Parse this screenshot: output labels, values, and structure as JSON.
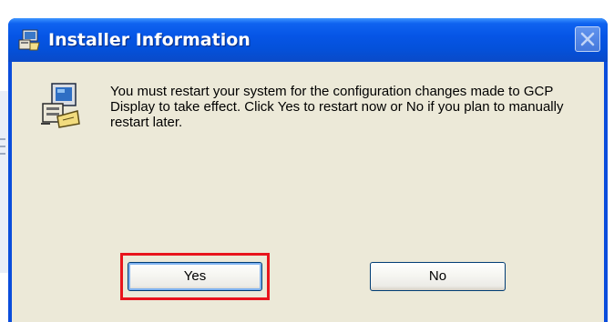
{
  "window": {
    "title": "Installer Information",
    "icon": "installer-icon",
    "close_icon": "close-icon"
  },
  "dialog": {
    "icon": "computer-setup-icon",
    "message": "You must restart your system for the configuration changes made to GCP Display to take effect. Click Yes to restart now or No if you plan to manually restart later."
  },
  "buttons": {
    "yes_label": "Yes",
    "no_label": "No"
  },
  "annotation": {
    "highlight_color": "#e8141c",
    "highlighted_element": "yes-button"
  },
  "colors": {
    "titlebar": "#0655e6",
    "client_background": "#ece9d8",
    "button_border": "#003c74"
  }
}
